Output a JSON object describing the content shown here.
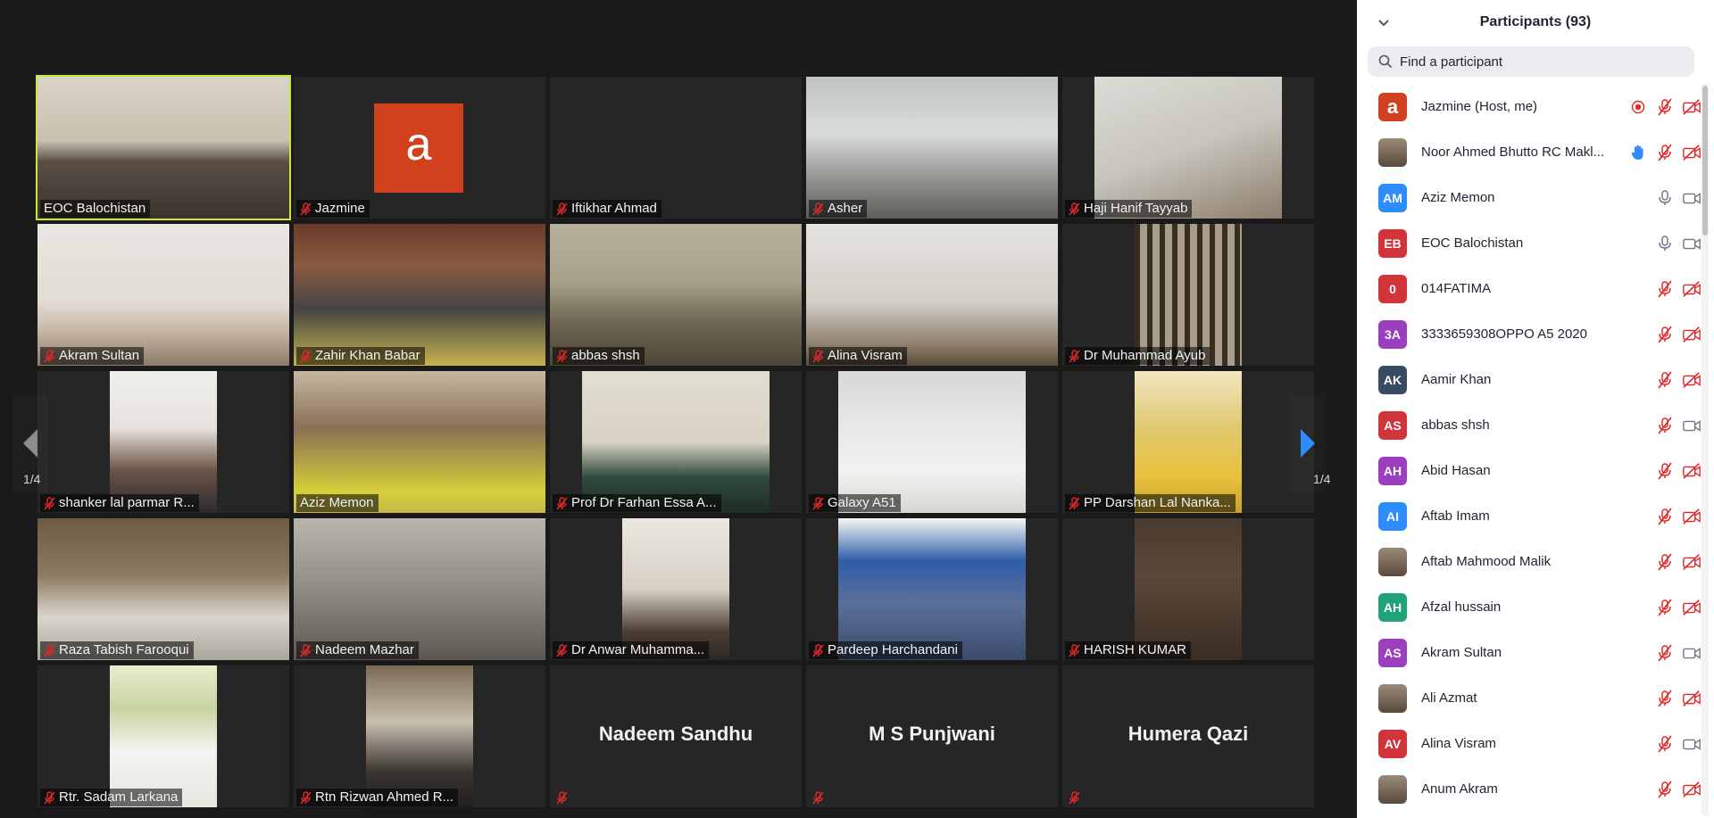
{
  "gallery": {
    "page_indicator_left": "1/4",
    "page_indicator_right": "1/4",
    "tiles": [
      {
        "name": "EOC Balochistan",
        "muted": false,
        "scene": "sc-office",
        "video": "full",
        "active": true
      },
      {
        "name": "Jazmine",
        "muted": true,
        "scene": "avatar",
        "avatar_letter": "a"
      },
      {
        "name": "Iftikhar Ahmad",
        "muted": true,
        "scene": "none"
      },
      {
        "name": "Asher",
        "muted": true,
        "scene": "sc-room1",
        "video": "full"
      },
      {
        "name": "Haji Hanif Tayyab",
        "muted": true,
        "scene": "sc-room2",
        "video": "mid"
      },
      {
        "name": "Akram Sultan",
        "muted": true,
        "scene": "sc-person1",
        "video": "full"
      },
      {
        "name": "Zahir Khan  Babar",
        "muted": true,
        "scene": "sc-person2",
        "video": "full"
      },
      {
        "name": "abbas shsh",
        "muted": true,
        "scene": "sc-shelf",
        "video": "full"
      },
      {
        "name": "Alina Visram",
        "muted": true,
        "scene": "sc-wall",
        "video": "full"
      },
      {
        "name": "Dr Muhammad Ayub",
        "muted": true,
        "scene": "sc-window",
        "video": "narrow"
      },
      {
        "name": "shanker lal parmar R...",
        "muted": true,
        "scene": "sc-face",
        "video": "narrow"
      },
      {
        "name": "Aziz Memon",
        "muted": false,
        "scene": "sc-books",
        "video": "full"
      },
      {
        "name": "Prof Dr Farhan Essa A...",
        "muted": true,
        "scene": "sc-green",
        "video": "mid"
      },
      {
        "name": "Galaxy A51",
        "muted": true,
        "scene": "sc-white",
        "video": "mid"
      },
      {
        "name": "PP Darshan Lal Nanka...",
        "muted": true,
        "scene": "sc-yellow",
        "video": "narrow"
      },
      {
        "name": "Raza Tabish Farooqui",
        "muted": true,
        "scene": "sc-shelf2",
        "video": "full"
      },
      {
        "name": "Nadeem Mazhar",
        "muted": true,
        "scene": "sc-grey",
        "video": "full"
      },
      {
        "name": "Dr Anwar Muhamma...",
        "muted": true,
        "scene": "sc-ceiling",
        "video": "narrow"
      },
      {
        "name": "Pardeep Harchandani",
        "muted": true,
        "scene": "sc-poster",
        "video": "mid"
      },
      {
        "name": "HARISH KUMAR",
        "muted": true,
        "scene": "sc-dark",
        "video": "narrow"
      },
      {
        "name": "Rtr. Sadam Larkana",
        "muted": true,
        "scene": "sc-tree",
        "video": "narrow"
      },
      {
        "name": "Rtn Rizwan Ahmed R...",
        "muted": true,
        "scene": "sc-frame",
        "video": "narrow"
      },
      {
        "name": "",
        "big_name": "Nadeem Sandhu",
        "muted": true,
        "scene": "none"
      },
      {
        "name": "",
        "big_name": "M S Punjwani",
        "muted": true,
        "scene": "none"
      },
      {
        "name": "",
        "big_name": "Humera Qazi",
        "muted": true,
        "scene": "none"
      }
    ]
  },
  "panel": {
    "title": "Participants (93)",
    "search_placeholder": "Find a participant",
    "participants": [
      {
        "name": "Jazmine (Host, me)",
        "initials": "a",
        "color": "#d1411d",
        "initials_size": "big",
        "recording": true,
        "mic": "off",
        "video": "off"
      },
      {
        "name": "Noor Ahmed Bhutto RC Makl...",
        "initials": "",
        "photo": true,
        "hand": true,
        "mic": "off",
        "video": "off"
      },
      {
        "name": "Aziz Memon",
        "initials": "AM",
        "color": "#2d8cff",
        "mic": "on",
        "video": "on"
      },
      {
        "name": "EOC Balochistan",
        "initials": "EB",
        "color": "#d1343a",
        "mic": "on",
        "video": "on"
      },
      {
        "name": "014FATIMA",
        "initials": "0",
        "color": "#d1343a",
        "mic": "off",
        "video": "off"
      },
      {
        "name": "3333659308OPPO A5 2020",
        "initials": "3A",
        "color": "#9b3fbf",
        "mic": "off",
        "video": "off"
      },
      {
        "name": "Aamir Khan",
        "initials": "AK",
        "color": "#3b4a63",
        "mic": "off",
        "video": "off"
      },
      {
        "name": "abbas shsh",
        "initials": "AS",
        "color": "#d1343a",
        "mic": "off",
        "video": "on"
      },
      {
        "name": "Abid Hasan",
        "initials": "AH",
        "color": "#9b3fbf",
        "mic": "off",
        "video": "off"
      },
      {
        "name": "Aftab Imam",
        "initials": "AI",
        "color": "#2d8cff",
        "mic": "off",
        "video": "off"
      },
      {
        "name": "Aftab Mahmood Malik",
        "initials": "",
        "photo": true,
        "mic": "off",
        "video": "off"
      },
      {
        "name": "Afzal hussain",
        "initials": "AH",
        "color": "#1fa37a",
        "mic": "off",
        "video": "off"
      },
      {
        "name": "Akram Sultan",
        "initials": "AS",
        "color": "#9b3fbf",
        "mic": "off",
        "video": "on"
      },
      {
        "name": "Ali Azmat",
        "initials": "",
        "photo": true,
        "mic": "off",
        "video": "off"
      },
      {
        "name": "Alina Visram",
        "initials": "AV",
        "color": "#d1343a",
        "mic": "off",
        "video": "on"
      },
      {
        "name": "Anum Akram",
        "initials": "",
        "photo": true,
        "mic": "off",
        "video": "off"
      }
    ]
  },
  "colors": {
    "active_speaker_border": "#c8e63c",
    "muted_red": "#e02828",
    "next_arrow": "#2d8cff"
  }
}
